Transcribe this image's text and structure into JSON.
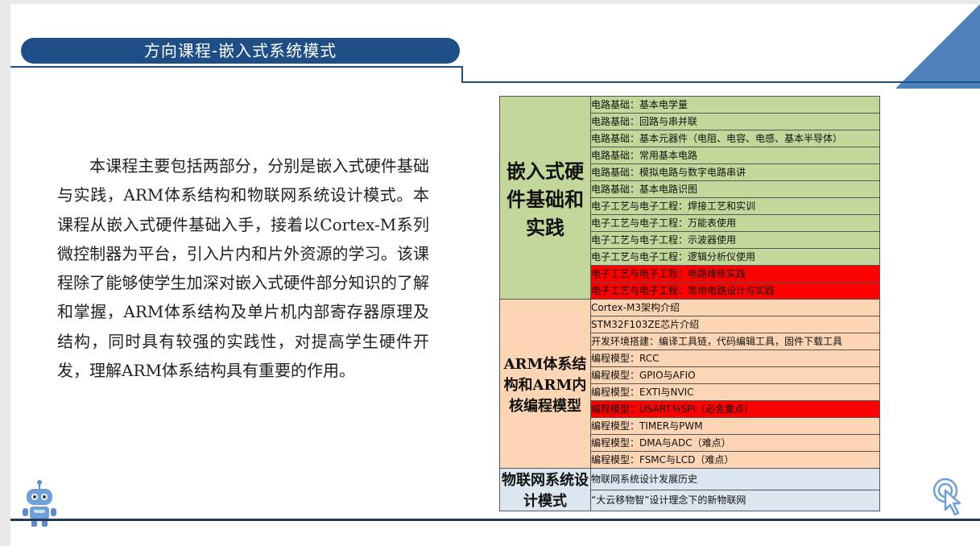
{
  "slide": {
    "title": "方向课程-嵌入式系统模式",
    "body": "本课程主要包括两部分，分别是嵌入式硬件基础与实践，ARM体系结构和物联网系统设计模式。本课程从嵌入式硬件基础入手，接着以Cortex-M系列微控制器为平台，引入片内和片外资源的学习。该课程除了能够使学生加深对嵌入式硬件部分知识的了解和掌握，ARM体系结构及单片机内部寄存器原理及结构，同时具有较强的实践性，对提高学生硬件开发，理解ARM体系结构具有重要的作用。"
  },
  "table": {
    "groups": [
      {
        "name": "嵌入式硬件基础和实践",
        "items": [
          "电路基础：基本电学量",
          "电路基础：回路与串并联",
          "电路基础：基本元器件（电阻、电容、电感、基本半导体）",
          "电路基础：常用基本电路",
          "电路基础：模拟电路与数字电路串讲",
          "电路基础：基本电路识图",
          "电子工艺与电子工程：焊接工艺和实训",
          "电子工艺与电子工程：万能表使用",
          "电子工艺与电子工程：示波器使用",
          "电子工艺与电子工程：逻辑分析仪使用",
          "电子工艺与电子工程：电路维修实践",
          "电子工艺与电子工程：常用电路设计与实践"
        ],
        "highlighted": [
          10,
          11
        ]
      },
      {
        "name": "ARM体系结构和ARM内核编程模型",
        "items": [
          "Cortex-M3架构介绍",
          "STM32F103ZE芯片介绍",
          "开发环境搭建：编译工具链，代码编辑工具，固件下载工具",
          "编程模型：RCC",
          "编程模型：GPIO与AFIO",
          "编程模型：EXTI与NVIC",
          "编程模型：USART与SPI（必会重点）",
          "编程模型：TIMER与PWM",
          "编程模型：DMA与ADC（难点）",
          "编程模型：FSMC与LCD（难点）"
        ],
        "highlighted": [
          6
        ]
      },
      {
        "name": "物联网系统设计模式",
        "items": [
          "物联网系统设计发展历史",
          "“大云移物智”设计理念下的新物联网"
        ],
        "highlighted": []
      }
    ]
  },
  "icons": {
    "robot": "robot-mascot-icon",
    "click": "click-pointer-icon"
  },
  "colors": {
    "title_bar": "#1f4e86",
    "corner": "#4f81bd",
    "group1": "#c4d79b",
    "group2": "#fcd5b4",
    "group3": "#dce6f1",
    "highlight": "#ff0000"
  }
}
